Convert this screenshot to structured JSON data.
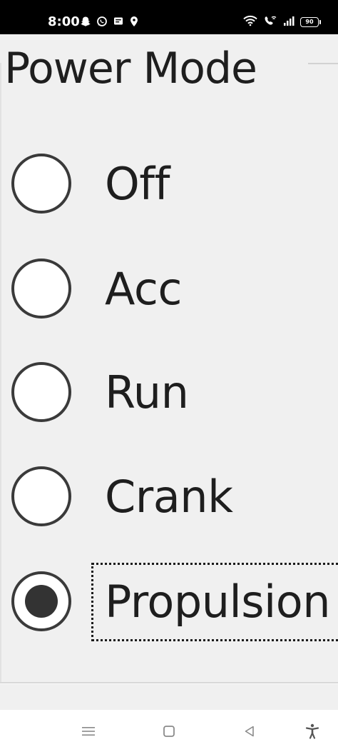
{
  "status_bar": {
    "time": "8:00",
    "battery_level": "90",
    "left_icons": [
      "snapchat-icon",
      "whatsapp-icon",
      "message-icon",
      "location-icon"
    ],
    "right_icons": [
      "wifi-icon",
      "vowifi-call-icon",
      "signal-icon",
      "battery-icon"
    ]
  },
  "group": {
    "title": "Power Mode",
    "options": [
      {
        "label": "Off",
        "checked": false
      },
      {
        "label": "Acc",
        "checked": false
      },
      {
        "label": "Run",
        "checked": false
      },
      {
        "label": "Crank",
        "checked": false
      },
      {
        "label": "Propulsion",
        "checked": true
      }
    ]
  },
  "nav_bar": {
    "buttons": [
      "menu-icon",
      "home-icon",
      "back-icon",
      "accessibility-icon"
    ]
  },
  "colors": {
    "background": "#f0f0f0",
    "text": "#1e1e1e",
    "radio_border": "#3a3a3a",
    "radio_dot": "#333333"
  }
}
